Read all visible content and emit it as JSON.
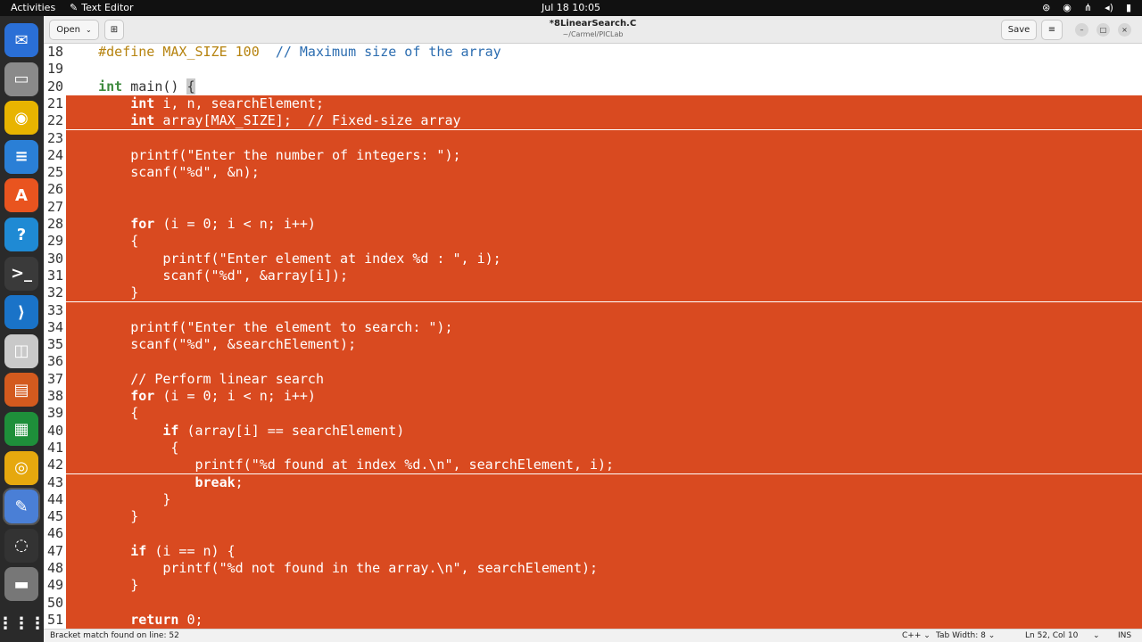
{
  "topbar": {
    "activities": "Activities",
    "app_name": "Text Editor",
    "clock": "Jul 18  10:05"
  },
  "dock": {
    "items": [
      {
        "name": "thunderbird-icon",
        "color": "#2a6fd6",
        "glyph": "✉"
      },
      {
        "name": "files-icon",
        "color": "#8a8a8a",
        "glyph": "▭"
      },
      {
        "name": "rhythmbox-icon",
        "color": "#e8b400",
        "glyph": "◉"
      },
      {
        "name": "writer-icon",
        "color": "#2a7fd6",
        "glyph": "≡"
      },
      {
        "name": "app-center-icon",
        "color": "#e9541f",
        "glyph": "A"
      },
      {
        "name": "help-icon",
        "color": "#1f8ad4",
        "glyph": "?"
      },
      {
        "name": "terminal-icon",
        "color": "#3a3a3a",
        "glyph": ">_"
      },
      {
        "name": "vscode-icon",
        "color": "#1a73c8",
        "glyph": "⟩"
      },
      {
        "name": "document-viewer-icon",
        "color": "#c9c9c9",
        "glyph": "◫"
      },
      {
        "name": "impress-icon",
        "color": "#d35a1e",
        "glyph": "▤"
      },
      {
        "name": "calc-icon",
        "color": "#1e8f3a",
        "glyph": "▦"
      },
      {
        "name": "chrome-icon",
        "color": "#e6a80e",
        "glyph": "◎"
      },
      {
        "name": "text-editor-icon",
        "color": "#4a7fd6",
        "glyph": "✎"
      },
      {
        "name": "obs-icon",
        "color": "#333333",
        "glyph": "◌"
      },
      {
        "name": "drive-icon",
        "color": "#777777",
        "glyph": "▬"
      },
      {
        "name": "show-apps-icon",
        "color": "#2a2a2a",
        "glyph": "⋮⋮⋮"
      }
    ]
  },
  "header": {
    "open_label": "Open",
    "title": "*8LinearSearch.C",
    "subtitle": "~/Carmel/PICLab",
    "save_label": "Save"
  },
  "editor": {
    "lines": [
      {
        "n": "18",
        "text": "    #define MAX_SIZE 100  // Maximum size of the array",
        "selected": false
      },
      {
        "n": "19",
        "text": "",
        "selected": false
      },
      {
        "n": "20",
        "text": "    int main() {",
        "selected": false
      },
      {
        "n": "21",
        "text": "        int i, n, searchElement;",
        "selected": true
      },
      {
        "n": "22",
        "text": "        int array[MAX_SIZE];  // Fixed-size array",
        "selected": true
      },
      {
        "n": "23",
        "text": "",
        "selected": true
      },
      {
        "n": "24",
        "text": "        printf(\"Enter the number of integers: \");",
        "selected": true
      },
      {
        "n": "25",
        "text": "        scanf(\"%d\", &n);",
        "selected": true
      },
      {
        "n": "26",
        "text": "",
        "selected": true
      },
      {
        "n": "27",
        "text": "",
        "selected": true
      },
      {
        "n": "28",
        "text": "        for (i = 0; i < n; i++)",
        "selected": true
      },
      {
        "n": "29",
        "text": "        {",
        "selected": true
      },
      {
        "n": "30",
        "text": "            printf(\"Enter element at index %d : \", i);",
        "selected": true
      },
      {
        "n": "31",
        "text": "            scanf(\"%d\", &array[i]);",
        "selected": true
      },
      {
        "n": "32",
        "text": "        }",
        "selected": true
      },
      {
        "n": "33",
        "text": "",
        "selected": true
      },
      {
        "n": "34",
        "text": "        printf(\"Enter the element to search: \");",
        "selected": true
      },
      {
        "n": "35",
        "text": "        scanf(\"%d\", &searchElement);",
        "selected": true
      },
      {
        "n": "36",
        "text": "",
        "selected": true
      },
      {
        "n": "37",
        "text": "        // Perform linear search",
        "selected": true
      },
      {
        "n": "38",
        "text": "        for (i = 0; i < n; i++)",
        "selected": true
      },
      {
        "n": "39",
        "text": "        {",
        "selected": true
      },
      {
        "n": "40",
        "text": "            if (array[i] == searchElement)",
        "selected": true
      },
      {
        "n": "41",
        "text": "             {",
        "selected": true
      },
      {
        "n": "42",
        "text": "                printf(\"%d found at index %d.\\n\", searchElement, i);",
        "selected": true
      },
      {
        "n": "43",
        "text": "                break;",
        "selected": true
      },
      {
        "n": "44",
        "text": "            }",
        "selected": true
      },
      {
        "n": "45",
        "text": "        }",
        "selected": true
      },
      {
        "n": "46",
        "text": "",
        "selected": true
      },
      {
        "n": "47",
        "text": "        if (i == n) {",
        "selected": true
      },
      {
        "n": "48",
        "text": "            printf(\"%d not found in the array.\\n\", searchElement);",
        "selected": true
      },
      {
        "n": "49",
        "text": "        }",
        "selected": true
      },
      {
        "n": "50",
        "text": "",
        "selected": true
      },
      {
        "n": "51",
        "text": "        return 0;",
        "selected": true
      }
    ]
  },
  "status": {
    "message": "Bracket match found on line: 52",
    "language": "C++ ⌄",
    "tab_width": "Tab Width: 8 ⌄",
    "position": "Ln 52, Col 10",
    "mode": "INS"
  },
  "colors": {
    "selection": "#d94a20",
    "keyword": "#3d8a3d",
    "preprocessor": "#b6830f",
    "comment": "#2c6db0"
  }
}
